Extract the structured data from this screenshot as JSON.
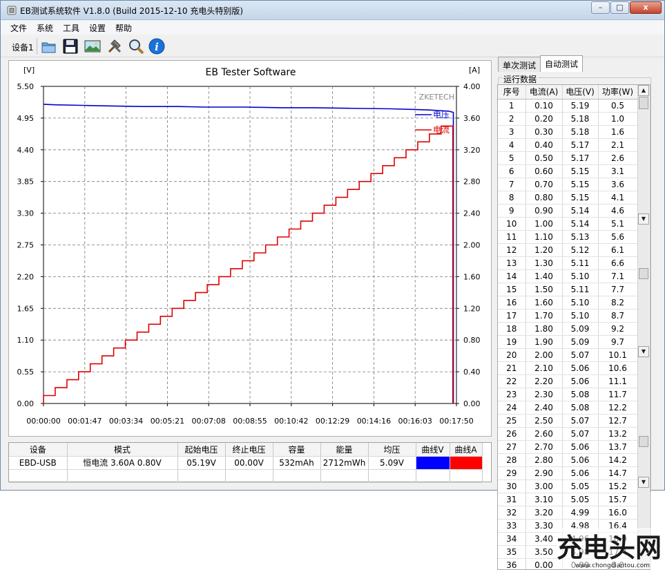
{
  "window": {
    "title": "EB测试系统软件 V1.8.0 (Build 2015-12-10 充电头特别版)",
    "controls": {
      "minimize": "–",
      "maximize": "□",
      "close": "x"
    }
  },
  "menu": [
    "文件",
    "系统",
    "工具",
    "设置",
    "帮助"
  ],
  "toolbar": {
    "device_label": "设备1",
    "buttons": [
      "open-folder",
      "save",
      "picture",
      "tools",
      "search",
      "info"
    ]
  },
  "chart_data": {
    "type": "line",
    "title": "EB Tester Software",
    "brand": "ZKETECH",
    "ylabel_left": "[V]",
    "ylabel_right": "[A]",
    "y_left_ticks": [
      "5.50",
      "4.95",
      "4.40",
      "3.85",
      "3.30",
      "2.75",
      "2.20",
      "1.65",
      "1.10",
      "0.55",
      "0.00"
    ],
    "y_right_ticks": [
      "4.00",
      "3.60",
      "3.20",
      "2.80",
      "2.40",
      "2.00",
      "1.60",
      "1.20",
      "0.80",
      "0.40",
      "0.00"
    ],
    "x_ticks": [
      "00:00:00",
      "00:01:47",
      "00:03:34",
      "00:05:21",
      "00:07:08",
      "00:08:55",
      "00:10:42",
      "00:12:29",
      "00:14:16",
      "00:16:03",
      "00:17:50"
    ],
    "ylim_left": [
      0,
      5.5
    ],
    "ylim_right": [
      0,
      4.0
    ],
    "xlim_seconds": [
      0,
      1070
    ],
    "grid": true,
    "legend_position": "top-right",
    "series": [
      {
        "name": "电压",
        "axis": "left",
        "color": "#0000cc",
        "x": [
          0,
          30,
          100,
          180,
          260,
          350,
          420,
          520,
          620,
          700,
          790,
          900,
          960,
          1000,
          1050,
          1062
        ],
        "y": [
          5.19,
          5.18,
          5.17,
          5.16,
          5.15,
          5.15,
          5.14,
          5.14,
          5.13,
          5.13,
          5.12,
          5.11,
          5.1,
          5.09,
          5.07,
          5.05
        ]
      },
      {
        "name": "电流",
        "axis": "right",
        "color": "#dd0000",
        "step_seconds": 30.3,
        "levels": [
          0.1,
          0.2,
          0.3,
          0.4,
          0.5,
          0.6,
          0.7,
          0.8,
          0.9,
          1.0,
          1.1,
          1.2,
          1.3,
          1.4,
          1.5,
          1.6,
          1.7,
          1.8,
          1.9,
          2.0,
          2.1,
          2.2,
          2.3,
          2.4,
          2.5,
          2.6,
          2.7,
          2.8,
          2.9,
          3.0,
          3.1,
          3.2,
          3.3,
          3.4,
          3.5
        ],
        "end_value": 0.0
      }
    ]
  },
  "tabs": [
    "单次测试",
    "自动测试"
  ],
  "active_tab": 1,
  "run_data": {
    "title": "运行数据",
    "columns": [
      "序号",
      "电流(A)",
      "电压(V)",
      "功率(W)"
    ],
    "rows": [
      [
        "1",
        "0.10",
        "5.19",
        "0.5"
      ],
      [
        "2",
        "0.20",
        "5.18",
        "1.0"
      ],
      [
        "3",
        "0.30",
        "5.18",
        "1.6"
      ],
      [
        "4",
        "0.40",
        "5.17",
        "2.1"
      ],
      [
        "5",
        "0.50",
        "5.17",
        "2.6"
      ],
      [
        "6",
        "0.60",
        "5.15",
        "3.1"
      ],
      [
        "7",
        "0.70",
        "5.15",
        "3.6"
      ],
      [
        "8",
        "0.80",
        "5.15",
        "4.1"
      ],
      [
        "9",
        "0.90",
        "5.14",
        "4.6"
      ],
      [
        "10",
        "1.00",
        "5.14",
        "5.1"
      ],
      [
        "11",
        "1.10",
        "5.13",
        "5.6"
      ],
      [
        "12",
        "1.20",
        "5.12",
        "6.1"
      ],
      [
        "13",
        "1.30",
        "5.11",
        "6.6"
      ],
      [
        "14",
        "1.40",
        "5.10",
        "7.1"
      ],
      [
        "15",
        "1.50",
        "5.11",
        "7.7"
      ],
      [
        "16",
        "1.60",
        "5.10",
        "8.2"
      ],
      [
        "17",
        "1.70",
        "5.10",
        "8.7"
      ],
      [
        "18",
        "1.80",
        "5.09",
        "9.2"
      ],
      [
        "19",
        "1.90",
        "5.09",
        "9.7"
      ],
      [
        "20",
        "2.00",
        "5.07",
        "10.1"
      ],
      [
        "21",
        "2.10",
        "5.06",
        "10.6"
      ],
      [
        "22",
        "2.20",
        "5.06",
        "11.1"
      ],
      [
        "23",
        "2.30",
        "5.08",
        "11.7"
      ],
      [
        "24",
        "2.40",
        "5.08",
        "12.2"
      ],
      [
        "25",
        "2.50",
        "5.07",
        "12.7"
      ],
      [
        "26",
        "2.60",
        "5.07",
        "13.2"
      ],
      [
        "27",
        "2.70",
        "5.06",
        "13.7"
      ],
      [
        "28",
        "2.80",
        "5.06",
        "14.2"
      ],
      [
        "29",
        "2.90",
        "5.06",
        "14.7"
      ],
      [
        "30",
        "3.00",
        "5.05",
        "15.2"
      ],
      [
        "31",
        "3.10",
        "5.05",
        "15.7"
      ],
      [
        "32",
        "3.20",
        "4.99",
        "16.0"
      ],
      [
        "33",
        "3.30",
        "4.98",
        "16.4"
      ],
      [
        "34",
        "3.40",
        "4.96",
        "16.9"
      ],
      [
        "35",
        "3.50",
        "4.98",
        "17.4"
      ],
      [
        "36",
        "0.00",
        "0.00",
        "0.0"
      ]
    ]
  },
  "info": {
    "columns": [
      "设备",
      "模式",
      "起始电压",
      "终止电压",
      "容量",
      "能量",
      "均压",
      "曲线V",
      "曲线A"
    ],
    "row": [
      "EBD-USB",
      "恒电流  3.60A  0.80V",
      "05.19V",
      "00.00V",
      "532mAh",
      "2712mWh",
      "5.09V"
    ],
    "curve_v_color": "#0000ff",
    "curve_a_color": "#ff0000"
  },
  "watermark": {
    "text": "充电头网",
    "url": "www.chongdiantou.com"
  }
}
